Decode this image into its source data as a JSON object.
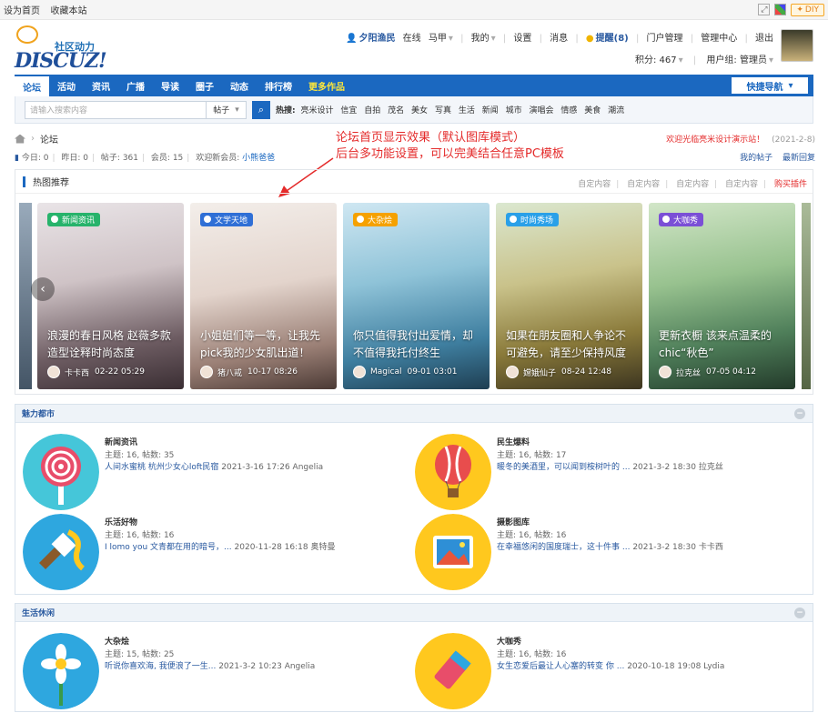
{
  "topbar": {
    "set_home": "设为首页",
    "bookmark": "收藏本站",
    "diy": "DIY"
  },
  "logo": {
    "slogan": "社区动力",
    "word": "DISCUZ!"
  },
  "user": {
    "name": "夕阳渔民",
    "online": "在线",
    "links": [
      "马甲",
      "我的",
      "设置",
      "消息"
    ],
    "remind": "提醒(8)",
    "admin_links": [
      "门户管理",
      "管理中心",
      "退出"
    ],
    "credits": "积分: 467",
    "group": "用户组: 管理员"
  },
  "nav": {
    "items": [
      "论坛",
      "活动",
      "资讯",
      "广播",
      "导读",
      "圈子",
      "动态",
      "排行榜",
      "更多作品"
    ],
    "active_index": 0,
    "quick": "快捷导航"
  },
  "search": {
    "placeholder": "请输入搜索内容",
    "type": "帖子",
    "hot_label": "热搜:",
    "hot_words": [
      "亮米设计",
      "信宜",
      "自拍",
      "茂名",
      "美女",
      "写真",
      "生活",
      "新闻",
      "城市",
      "演唱会",
      "情感",
      "美食",
      "潮流"
    ]
  },
  "breadcrumb": {
    "current": "论坛"
  },
  "welcome": {
    "text": "欢迎光临亮米设计演示站！",
    "date": "(2021-2-8)"
  },
  "stats": {
    "today": "今日: 0",
    "yesterday": "昨日: 0",
    "posts": "帖子: 361",
    "members": "会员: 15",
    "welcome_new": "欢迎新会员:",
    "new_member": "小熊爸爸"
  },
  "mylinks": [
    "我的帖子",
    "最新回复"
  ],
  "annotation": {
    "line1": "论坛首页显示效果（默认图库模式）",
    "line2": "后台多功能设置，可以完美结合任意PC模板"
  },
  "hot": {
    "title": "热图推荐",
    "custom_links": [
      "自定内容",
      "自定内容",
      "自定内容",
      "自定内容"
    ],
    "buy": "购买插件",
    "cards": [
      {
        "tag": "新闻资讯",
        "tag_color": "#27b36b",
        "title": "浪漫的春日风格 赵薇多款造型诠释时尚态度",
        "author": "卡卡西",
        "time": "02-22 05:29"
      },
      {
        "tag": "文学天地",
        "tag_color": "#2f6fd6",
        "title": "小姐姐们等一等，让我先pick我的少女肌出道！",
        "author": "猪八戒",
        "time": "10-17 08:26"
      },
      {
        "tag": "大杂烩",
        "tag_color": "#f5a100",
        "title": "你只值得我付出爱情，却不值得我托付终生",
        "author": "Magical",
        "time": "09-01 03:01"
      },
      {
        "tag": "时尚秀场",
        "tag_color": "#2aa0e8",
        "title": "如果在朋友圈和人争论不可避免，请至少保持风度",
        "author": "嫦娥仙子",
        "time": "08-24 12:48"
      },
      {
        "tag": "大咖秀",
        "tag_color": "#7b4fd6",
        "title": "更新衣橱 该来点温柔的chic“秋色”",
        "author": "拉克丝",
        "time": "07-05 04:12"
      }
    ]
  },
  "sections": [
    {
      "title": "魅力都市",
      "forums": [
        {
          "name": "新闻资讯",
          "count": "主题: 16, 帖数: 35",
          "last_link": "人间水蜜桃 杭州少女心loft民宿",
          "last_time": "2021-3-16 17:26 Angelia",
          "icon": "lollipop-icon"
        },
        {
          "name": "民生爆料",
          "count": "主题: 16, 帖数: 17",
          "last_link": "暖冬的美酒里，可以闻到桉树叶的 ...",
          "last_time": "2021-3-2 18:30 拉克丝",
          "icon": "hot-air-balloon-icon"
        },
        {
          "name": "乐活好物",
          "count": "主题: 16, 帖数: 16",
          "last_link": "I lomo you 文青都在用的暗号，...",
          "last_time": "2020-11-28 16:18 奥特曼",
          "icon": "paintbrush-icon"
        },
        {
          "name": "摄影图库",
          "count": "主题: 16, 帖数: 16",
          "last_link": "在幸福悠闲的国度瑞士，这十件事 ...",
          "last_time": "2021-3-2 18:30 卡卡西",
          "icon": "photo-icon"
        }
      ]
    },
    {
      "title": "生活休闲",
      "forums": [
        {
          "name": "大杂烩",
          "count": "主题: 15, 帖数: 25",
          "last_link": "听说你喜欢海, 我便浪了一生...",
          "last_time": "2021-3-2 10:23 Angelia",
          "icon": "flower-icon"
        },
        {
          "name": "大咖秀",
          "count": "主题: 16, 帖数: 16",
          "last_link": "女生恋爱后最让人心塞的转变 你 ...",
          "last_time": "2020-10-18 19:08 Lydia",
          "icon": "eraser-icon"
        }
      ]
    }
  ]
}
